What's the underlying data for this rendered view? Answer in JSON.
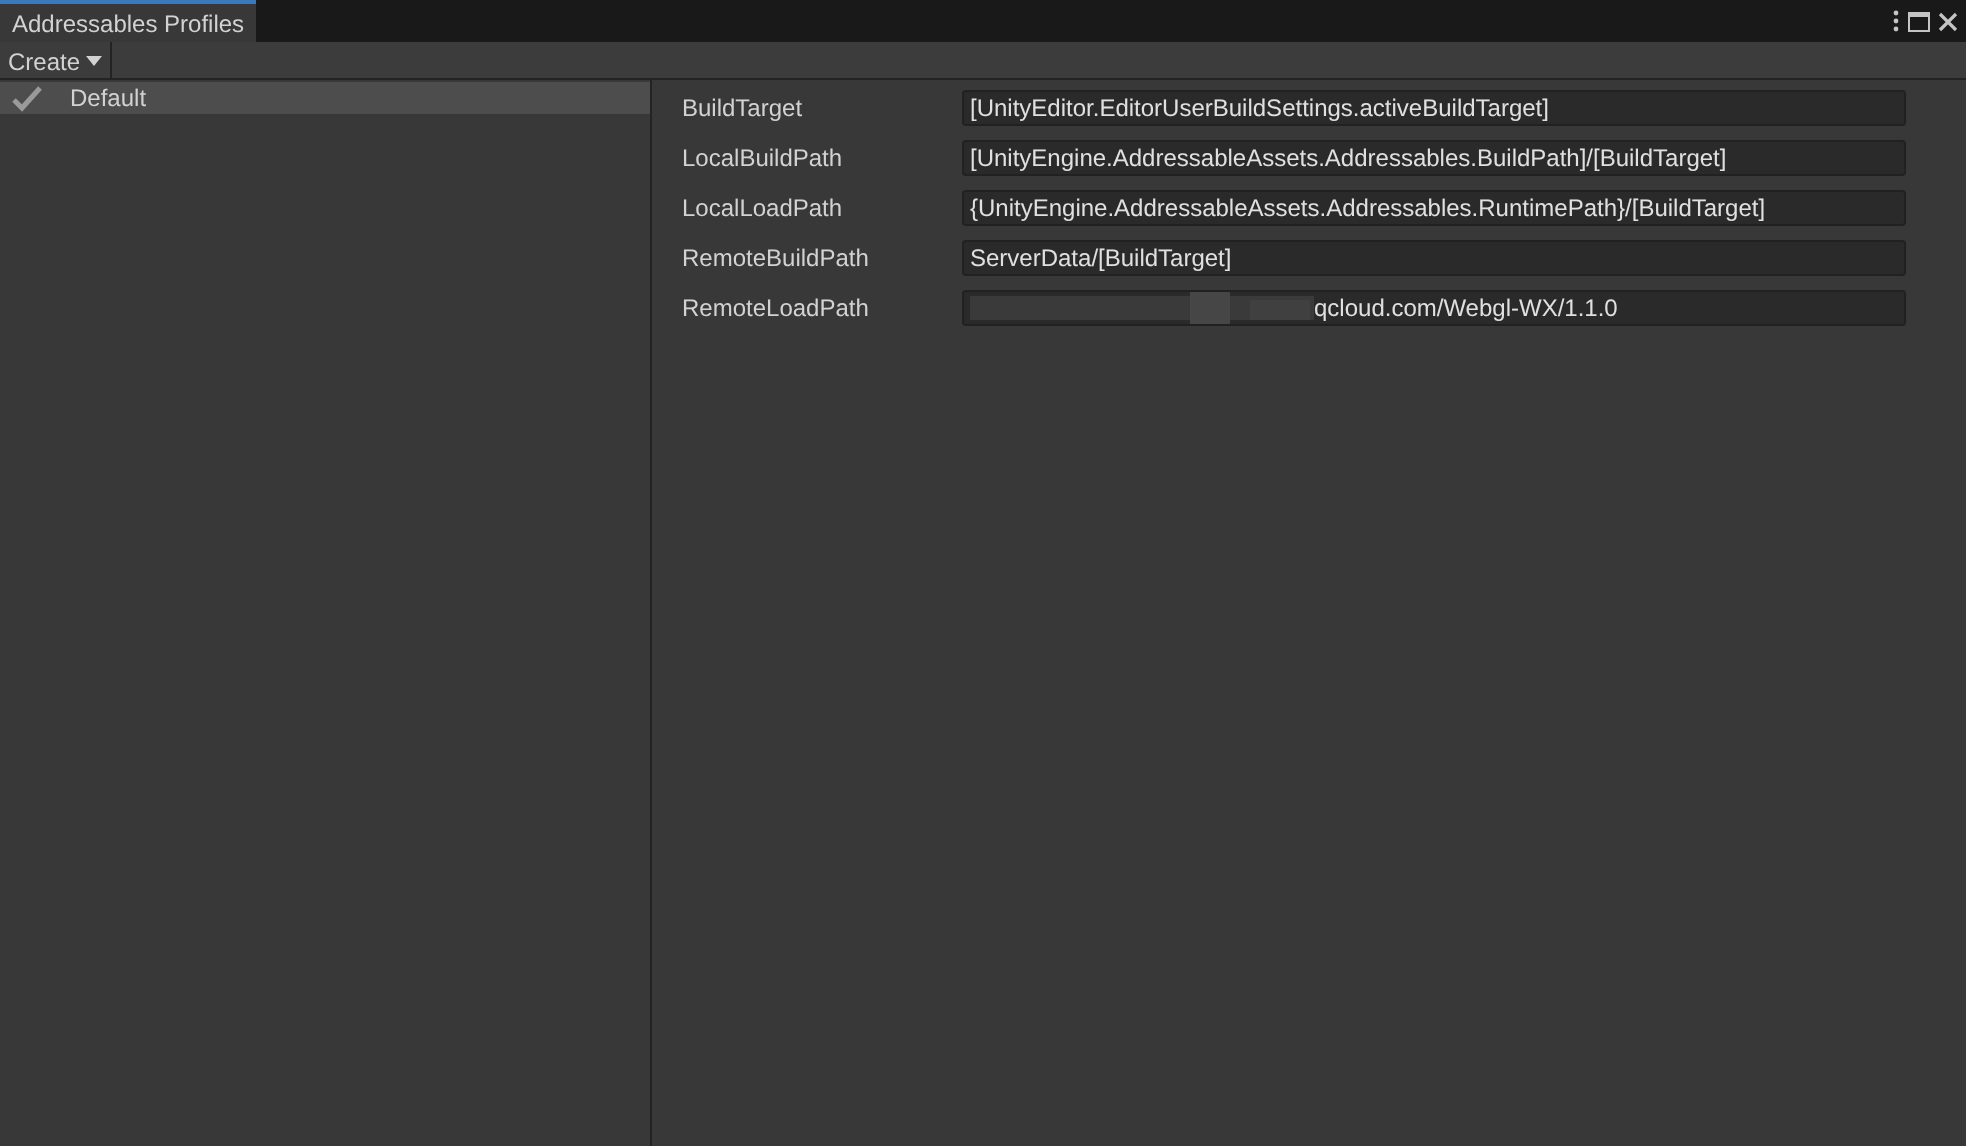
{
  "window": {
    "title": "Addressables Profiles"
  },
  "toolbar": {
    "create_button": "Create"
  },
  "profiles": [
    {
      "name": "Default",
      "selected": true,
      "checked": true
    }
  ],
  "variables": [
    {
      "name": "BuildTarget",
      "value": "[UnityEditor.EditorUserBuildSettings.activeBuildTarget]",
      "redacted": false
    },
    {
      "name": "LocalBuildPath",
      "value": "[UnityEngine.AddressableAssets.Addressables.BuildPath]/[BuildTarget]",
      "redacted": false
    },
    {
      "name": "LocalLoadPath",
      "value": "{UnityEngine.AddressableAssets.Addressables.RuntimePath}/[BuildTarget]",
      "redacted": false
    },
    {
      "name": "RemoteBuildPath",
      "value": "ServerData/[BuildTarget]",
      "redacted": false
    },
    {
      "name": "RemoteLoadPath",
      "value": "qcloud.com/Webgl-WX/1.1.0",
      "redacted": true
    }
  ]
}
